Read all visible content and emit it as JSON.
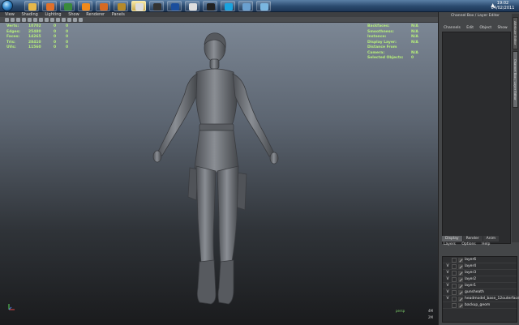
{
  "taskbar": {
    "apps": [
      {
        "icon": "folder-icon",
        "color": "#e5b74a"
      },
      {
        "icon": "firefox-icon",
        "color": "#e0702a"
      },
      {
        "icon": "media-player-icon",
        "color": "#3a8a3c"
      },
      {
        "icon": "vlc-icon",
        "color": "#f08a1a"
      },
      {
        "icon": "media-icon",
        "color": "#d66a22"
      },
      {
        "icon": "winamp-icon",
        "color": "#b58a2a"
      },
      {
        "icon": "music-icon",
        "color": "#dddddd"
      },
      {
        "icon": "steam-icon",
        "color": "#333333"
      },
      {
        "icon": "photoshop-icon",
        "color": "#1b4e9c"
      },
      {
        "icon": "maya-icon",
        "color": "#dddddd"
      },
      {
        "icon": "zbrush-icon",
        "color": "#222222"
      },
      {
        "icon": "skype-icon",
        "color": "#1aa3df"
      },
      {
        "icon": "window-icon",
        "color": "#6aa0d0"
      },
      {
        "icon": "explorer-icon",
        "color": "#7ab6e0"
      }
    ],
    "active_index": 6,
    "clock": {
      "time": "19:02",
      "date": "04/02/2011"
    }
  },
  "viewport": {
    "menu": [
      "View",
      "Shading",
      "Lighting",
      "Show",
      "Renderer",
      "Panels"
    ],
    "hud_left": [
      {
        "label": "Verts:",
        "v1": "10702",
        "v2": "0",
        "v3": "0"
      },
      {
        "label": "Edges:",
        "v1": "25480",
        "v2": "0",
        "v3": "0"
      },
      {
        "label": "Faces:",
        "v1": "14265",
        "v2": "0",
        "v3": "0"
      },
      {
        "label": "Tris:",
        "v1": "28410",
        "v2": "0",
        "v3": "0"
      },
      {
        "label": "UVs:",
        "v1": "11560",
        "v2": "0",
        "v3": "0"
      }
    ],
    "hud_right": [
      {
        "label": "Backfaces:",
        "value": "N/A"
      },
      {
        "label": "Smoothness:",
        "value": "N/A"
      },
      {
        "label": "Instance:",
        "value": "N/A"
      },
      {
        "label": "Display Layer:",
        "value": "N/A"
      },
      {
        "label": "Distance From Camera:",
        "value": "N/A"
      },
      {
        "label": "Selected Objects:",
        "value": "0"
      }
    ],
    "axis_label": "",
    "bottom_label": "persp",
    "corner_top": "4M",
    "corner_bottom": "2M"
  },
  "side_panel": {
    "title": "Channel Box / Layer Editor",
    "menu": [
      "Channels",
      "Edit",
      "Object",
      "Show"
    ],
    "vertical_tabs": [
      "Attribute Editor",
      "Channel Box / Layer Editor"
    ],
    "layer_tabs": [
      "Display",
      "Render",
      "Anim"
    ],
    "layer_menu": [
      "Layers",
      "Options",
      "Help"
    ],
    "layers": [
      {
        "visible": "",
        "name": "layer6"
      },
      {
        "visible": "V",
        "name": "layer4"
      },
      {
        "visible": "V",
        "name": "layer3"
      },
      {
        "visible": "V",
        "name": "layer2"
      },
      {
        "visible": "V",
        "name": "layer1"
      },
      {
        "visible": "V",
        "name": "gunsheath"
      },
      {
        "visible": "V",
        "name": "headmodel_base_12outerface"
      },
      {
        "visible": "",
        "name": "backup_geom"
      }
    ]
  }
}
